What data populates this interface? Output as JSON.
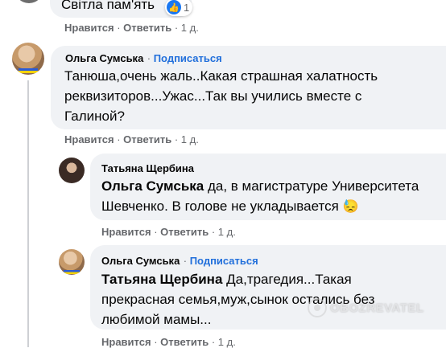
{
  "top_comment": {
    "text_partial": "Світла пам'ять",
    "reaction_count": "1"
  },
  "top_actions": {
    "like": "Нравится",
    "reply": "Ответить",
    "time": "1 д."
  },
  "comment1": {
    "author": "Ольга Сумська",
    "subscribe": "Подписаться",
    "lines": [
      "Танюша,очень жаль..Какая страшная халатность",
      "реквизиторов...Ужас...Так вы учились вместе с",
      "Галиной?"
    ],
    "actions": {
      "like": "Нравится",
      "reply": "Ответить",
      "time": "1 д."
    }
  },
  "reply1": {
    "author": "Татьяна Щербина",
    "mention": "Ольга Сумська",
    "line1_rest": " да, в магистратуре Университета",
    "line2": "Шевченко. В голове не укладывается",
    "emoji": "😓",
    "actions": {
      "like": "Нравится",
      "reply": "Ответить",
      "time": "1 д."
    }
  },
  "reply2": {
    "author": "Ольга Сумська",
    "subscribe": "Подписаться",
    "mention": "Татьяна Щербина",
    "line1_rest": " Да,трагедия...Такая",
    "line2": "прекрасная семья,муж,сынок остались без",
    "line3": "любимой мамы...",
    "actions": {
      "like": "Нравится",
      "reply": "Ответить",
      "time": "1 д."
    }
  },
  "watermark": "OBOZREVATEL",
  "colors": {
    "bubble": "#f0f2f5",
    "link": "#216fdb",
    "muted": "#65676b",
    "like_blue": "#1877f2"
  }
}
